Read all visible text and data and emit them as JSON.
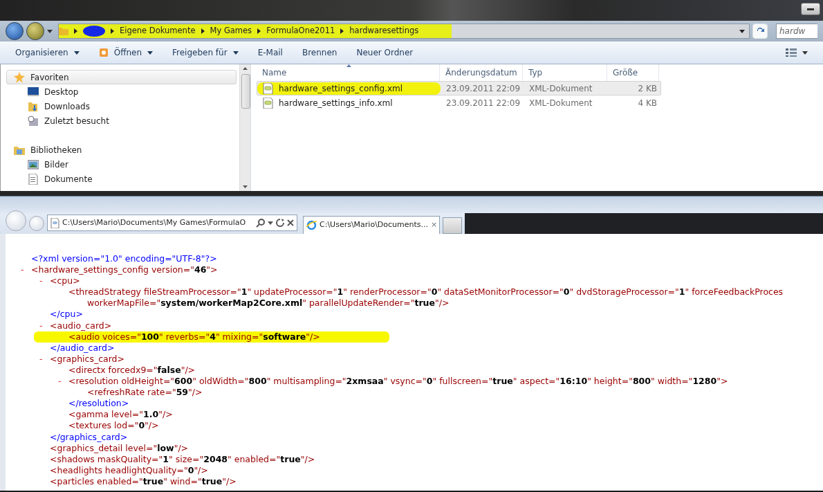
{
  "explorer": {
    "breadcrumb": [
      {
        "redacted": true
      },
      {
        "label": "Eigene Dokumente"
      },
      {
        "label": "My Games"
      },
      {
        "label": "FormulaOne2011"
      },
      {
        "label": "hardwaresettings"
      }
    ],
    "breadcrumb_highlighted": true,
    "search": {
      "placeholder": "hardw"
    },
    "toolbar": [
      {
        "label": "Organisieren",
        "kind": "menu"
      },
      {
        "label": "Öffnen",
        "kind": "split"
      },
      {
        "label": "Freigeben für",
        "kind": "menu"
      },
      {
        "label": "E-Mail",
        "kind": "plain"
      },
      {
        "label": "Brennen",
        "kind": "plain"
      },
      {
        "label": "Neuer Ordner",
        "kind": "plain"
      }
    ],
    "nav": [
      {
        "label": "Favoriten",
        "kind": "favorites",
        "selected": true,
        "children": [
          {
            "label": "Desktop",
            "kind": "desktop",
            "selected": false
          },
          {
            "label": "Downloads",
            "kind": "downloads",
            "selected": false
          },
          {
            "label": "Zuletzt besucht",
            "kind": "recent",
            "selected": false
          }
        ]
      },
      {
        "label": "Bibliotheken",
        "kind": "libraries",
        "selected": false,
        "children": [
          {
            "label": "Bilder",
            "kind": "pictures",
            "selected": false
          },
          {
            "label": "Dokumente",
            "kind": "documents",
            "selected": false
          }
        ]
      }
    ],
    "columns": [
      {
        "label": "Name",
        "sorted": true
      },
      {
        "label": "Änderungsdatum",
        "sorted": false
      },
      {
        "label": "Typ",
        "sorted": false
      },
      {
        "label": "Größe",
        "sorted": false
      }
    ],
    "files": [
      {
        "name": "hardware_settings_config.xml",
        "date": "23.09.2011 22:09",
        "type": "XML-Dokument",
        "size": "2 KB",
        "selected": true,
        "highlighted": true
      },
      {
        "name": "hardware_settings_info.xml",
        "date": "23.09.2011 22:09",
        "type": "XML-Dokument",
        "size": "4 KB",
        "selected": false,
        "highlighted": false
      }
    ]
  },
  "browser": {
    "address": "C:\\Users\\Mario\\Documents\\My Games\\FormulaO",
    "tabs": [
      {
        "title": "C:\\Users\\Mario\\Documents...",
        "close": "×",
        "selected": true
      }
    ],
    "xml": {
      "declaration": "<?xml version=\"1.0\" encoding=\"UTF-8\"?>",
      "nodes": [
        {
          "toggle": "-",
          "open": "<hardware_settings_config version=\"**46**\">",
          "children": [
            {
              "toggle": "-",
              "open": "<cpu>",
              "children": [
                {
                  "open": "<threadStrategy fileStreamProcessor=\"**1**\" updateProcessor=\"**1**\" renderProcessor=\"**0**\" dataSetMonitorProcessor=\"**0**\" dvdStorageProcessor=\"**1**\" forceFeedbackProces",
                  "continuation": "workerMapFile=\"**system/workerMap2Core.xml**\" parallelUpdateRender=\"**true**\"/>"
                }
              ],
              "close": "</cpu>"
            },
            {
              "toggle": "-",
              "open": "<audio_card>",
              "children": [
                {
                  "open": "<audio voices=\"**100**\" reverbs=\"**4**\" mixing=\"**software**\"/>",
                  "highlighted": true
                }
              ],
              "close": "</audio_card>"
            },
            {
              "toggle": "-",
              "open": "<graphics_card>",
              "children": [
                {
                  "open": "<directx forcedx9=\"**false**\"/>"
                },
                {
                  "toggle": "-",
                  "open": "<resolution oldHeight=\"**600**\" oldWidth=\"**800**\" multisampling=\"**2xmsaa**\" vsync=\"**0**\" fullscreen=\"**true**\" aspect=\"**16:10**\" height=\"**800**\" width=\"**1280**\">",
                  "children": [
                    {
                      "open": "<refreshRate rate=\"**59**\"/>"
                    }
                  ],
                  "close": "</resolution>"
                },
                {
                  "open": "<gamma level=\"**1.0**\"/>"
                },
                {
                  "open": "<textures lod=\"**0**\"/>"
                }
              ],
              "close": "</graphics_card>"
            },
            {
              "open": "<graphics_detail level=\"**low**\"/>"
            },
            {
              "open": "<shadows maskQuality=\"**1**\" size=\"**2048**\" enabled=\"**true**\"/>"
            },
            {
              "open": "<headlights headlightQuality=\"**0**\"/>"
            },
            {
              "open": "<particles enabled=\"**true**\" wind=\"**true**\"/>"
            }
          ]
        }
      ]
    }
  }
}
